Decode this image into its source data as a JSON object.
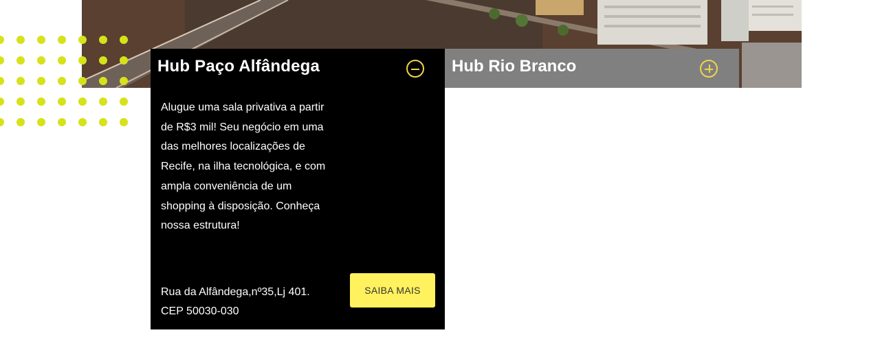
{
  "hero": {
    "image": "aerial-city-river-photo"
  },
  "colors": {
    "accent": "#fff25e",
    "dots": "#d6e21a",
    "panel_open_bg": "#000000",
    "panel_closed_bg": "#808080",
    "toggle": "#f2d44a"
  },
  "hubs": [
    {
      "title": "Hub Paço Alfândega",
      "state": "expanded",
      "toggle_icon": "minus-circle-icon",
      "description": "Alugue uma sala privativa a partir de R$3 mil! Seu negócio em uma das melhores localizações de Recife, na ilha tecnológica, e com ampla conveniência de um shopping à disposição. Conheça nossa estrutura!",
      "address_line1": "Rua da Alfândega,nº35,Lj 401.",
      "address_line2": "CEP 50030-030",
      "cta_label": "SAIBA MAIS"
    },
    {
      "title": "Hub Rio Branco",
      "state": "collapsed",
      "toggle_icon": "plus-circle-icon"
    }
  ]
}
